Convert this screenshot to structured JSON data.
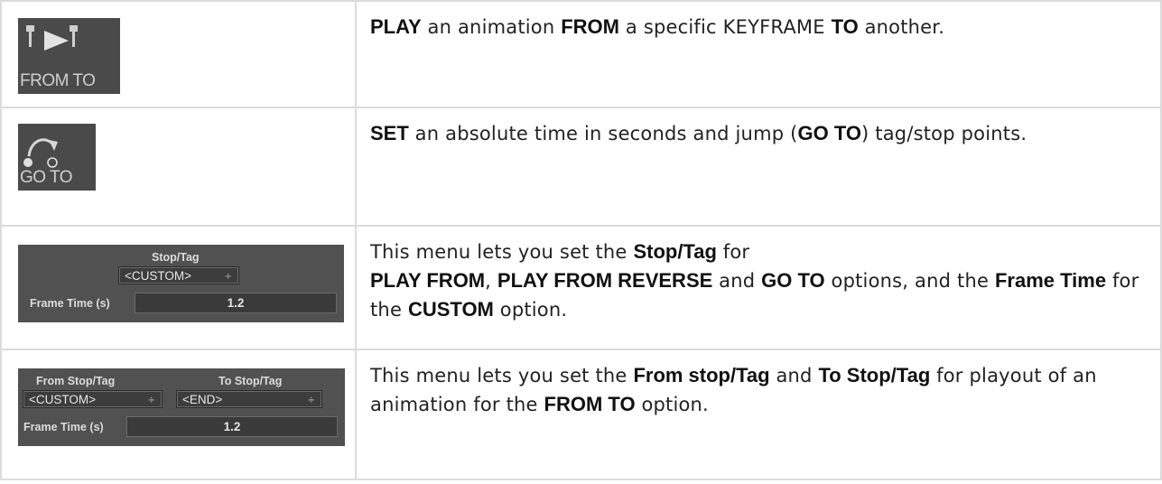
{
  "rows": {
    "from_to": {
      "icon_label": "FROM TO",
      "desc": [
        {
          "t": "PLAY",
          "b": true
        },
        {
          "t": " an animation ",
          "b": false
        },
        {
          "t": "FROM",
          "b": true
        },
        {
          "t": " a specific KEYFRAME ",
          "b": false
        },
        {
          "t": "TO",
          "b": true
        },
        {
          "t": " another.",
          "b": false
        }
      ]
    },
    "go_to": {
      "icon_label": "GO TO",
      "desc": [
        {
          "t": "SET",
          "b": true
        },
        {
          "t": " an absolute time in seconds and jump (",
          "b": false
        },
        {
          "t": "GO TO",
          "b": true
        },
        {
          "t": ") tag/stop points.",
          "b": false
        }
      ]
    },
    "stop_tag": {
      "panel": {
        "stop_tag_label": "Stop/Tag",
        "stop_tag_value": "<CUSTOM>",
        "select_arrow": "÷",
        "frame_time_label": "Frame Time (s)",
        "frame_time_value": "1.2"
      },
      "desc": [
        {
          "t": "This menu lets you set the ",
          "b": false
        },
        {
          "t": "Stop/Tag",
          "b": true
        },
        {
          "t": " for",
          "b": false
        },
        {
          "br": true
        },
        {
          "t": "PLAY FROM",
          "b": true
        },
        {
          "t": ", ",
          "b": false
        },
        {
          "t": "PLAY FROM REVERSE",
          "b": true
        },
        {
          "t": " and ",
          "b": false
        },
        {
          "t": "GO TO",
          "b": true
        },
        {
          "t": " options, and the ",
          "b": false
        },
        {
          "t": "Frame Time",
          "b": true
        },
        {
          "t": " for the ",
          "b": false
        },
        {
          "t": "CUSTOM",
          "b": true
        },
        {
          "t": " option.",
          "b": false
        }
      ]
    },
    "from_to_menu": {
      "panel": {
        "from_label": "From Stop/Tag",
        "from_value": "<CUSTOM>",
        "to_label": "To Stop/Tag",
        "to_value": "<END>",
        "select_arrow": "÷",
        "frame_time_label": "Frame Time (s)",
        "frame_time_value": "1.2"
      },
      "desc": [
        {
          "t": "This menu lets you set the ",
          "b": false
        },
        {
          "t": "From stop/Tag",
          "b": true
        },
        {
          "t": " and ",
          "b": false
        },
        {
          "t": "To Stop/Tag",
          "b": true
        },
        {
          "t": " for playout of an animation for the ",
          "b": false
        },
        {
          "t": "FROM TO",
          "b": true
        },
        {
          "t": " option.",
          "b": false
        }
      ]
    }
  },
  "colors": {
    "tile_bg": "#4a4a4a",
    "panel_bg": "#515151",
    "border": "#dcdcdc"
  }
}
